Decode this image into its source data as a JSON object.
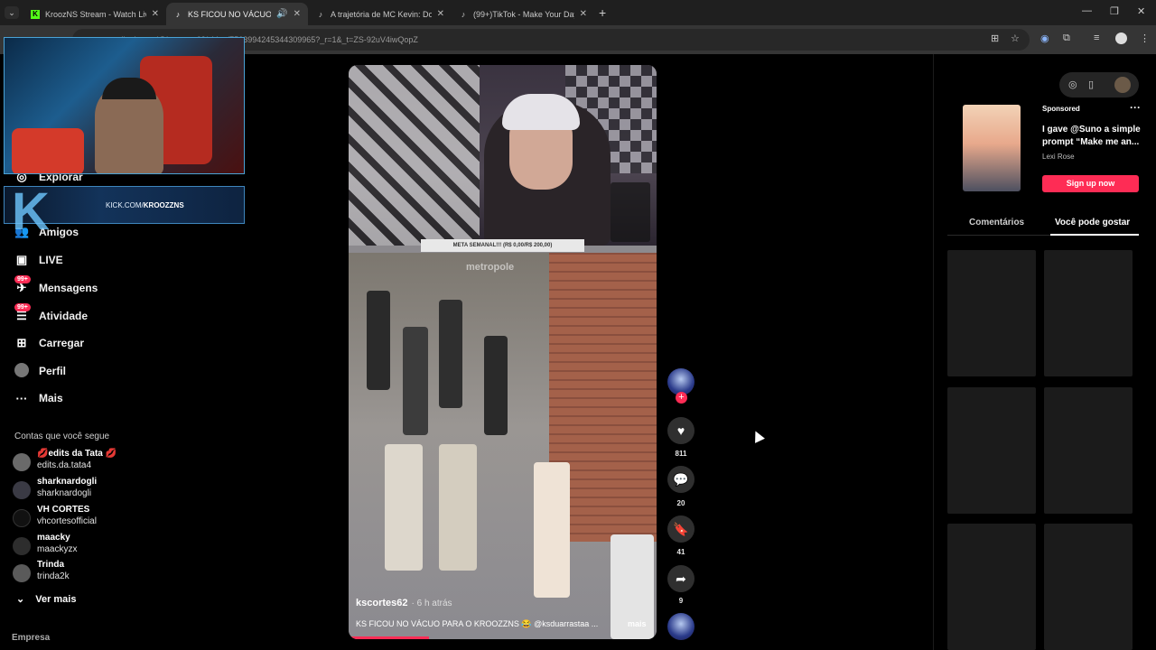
{
  "browser": {
    "tabs": [
      {
        "title": "KroozNS Stream - Watch Live",
        "active": false
      },
      {
        "title": "KS FICOU NO VÁCUO PARA",
        "active": true
      },
      {
        "title": "A trajetória de MC Kevin: Do a",
        "active": false
      },
      {
        "title": "(99+)TikTok - Make Your Day",
        "active": false
      }
    ],
    "url": "tiktok.com/@kscortes62/video/7503994245344309965?_r=1&_t=ZS-92uV4iwQopZ"
  },
  "sidebar": {
    "items": [
      {
        "label": "Explorar",
        "icon": "compass-icon"
      },
      {
        "label": "Amigos",
        "icon": "friends-icon"
      },
      {
        "label": "LIVE",
        "icon": "live-icon"
      },
      {
        "label": "Mensagens",
        "icon": "messages-icon",
        "badge": "99+"
      },
      {
        "label": "Atividade",
        "icon": "activity-icon",
        "badge": "99+"
      },
      {
        "label": "Carregar",
        "icon": "upload-icon"
      },
      {
        "label": "Perfil",
        "icon": "profile-avatar"
      },
      {
        "label": "Mais",
        "icon": "more-icon"
      }
    ],
    "following_title": "Contas que você segue",
    "accounts": [
      {
        "name": "💋edits da Tata 💋",
        "username": "edits.da.tata4"
      },
      {
        "name": "sharknardogli",
        "username": "sharknardogli"
      },
      {
        "name": "VH CORTES",
        "username": "vhcortesofficial"
      },
      {
        "name": "maacky",
        "username": "maackyzx"
      },
      {
        "name": "Trinda",
        "username": "trinda2k"
      }
    ],
    "see_more": "Ver mais",
    "footer": "Empresa"
  },
  "stream_overlay": {
    "kick_text_prefix": "KICK.COM/",
    "kick_text_channel": "KROOZZNS"
  },
  "video": {
    "meta_banner": "META SEMANAL!!! (R$ 0,00/R$ 200,00)",
    "watermark": "metropole",
    "author": "kscortes62",
    "time_ago": "· 6 h atrás",
    "caption": "KS FICOU NO VÁCUO PARA O KROOZZNS 😂 @ksduarrastaa ...",
    "more_label": "mais",
    "progress": 0.26
  },
  "actions": {
    "likes": "811",
    "comments": "20",
    "saves": "41",
    "shares": "9"
  },
  "right_panel": {
    "ad": {
      "sponsored_label": "Sponsored",
      "text": "I gave @Suno a simple prompt “Make me an...",
      "author": "Lexi Rose",
      "cta": "Sign up now"
    },
    "tabs": {
      "comments": "Comentários",
      "you_may_like": "Você pode gostar"
    }
  },
  "colors": {
    "accent": "#fe2c55",
    "background": "#000000"
  }
}
